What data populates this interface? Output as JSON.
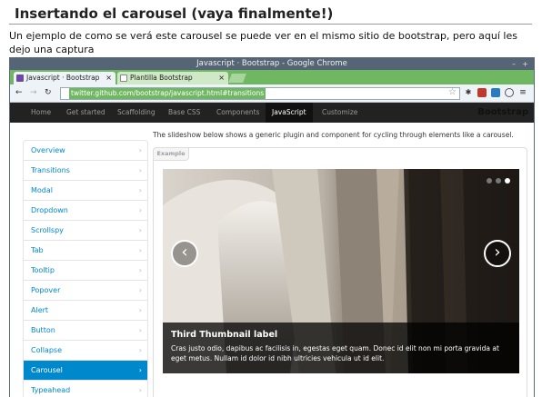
{
  "post": {
    "title": "Insertando el carousel (vaya finalmente!)",
    "intro": "Un ejemplo de como se verá este carousel se puede ver en el mismo sitio de bootstrap, pero aquí les dejo una captura"
  },
  "browser": {
    "window_title": "Javascript · Bootstrap - Google Chrome",
    "win_minimize": "–",
    "win_close": "+",
    "tabs": [
      {
        "label": "Javascript · Bootstrap",
        "close": "×",
        "active": true
      },
      {
        "label": "Plantilla Bootstrap",
        "close": "×",
        "active": false
      }
    ],
    "url": "twitter.github.com/bootstrap/javascript.html#transitions",
    "nav": {
      "back": "←",
      "forward": "→",
      "reload": "↻"
    },
    "star": "☆"
  },
  "bootstrap": {
    "nav_items": [
      "Home",
      "Get started",
      "Scaffolding",
      "Base CSS",
      "Components",
      "JavaScript",
      "Customize"
    ],
    "active_nav": "JavaScript",
    "brand": "Bootstrap",
    "lead": "The slideshow below shows a generic plugin and component for cycling through elements like a carousel.",
    "example_label": "Example",
    "sidenav": [
      {
        "label": "Overview",
        "chev": "›"
      },
      {
        "label": "Transitions",
        "chev": "›"
      },
      {
        "label": "Modal",
        "chev": "›"
      },
      {
        "label": "Dropdown",
        "chev": "›"
      },
      {
        "label": "Scrollspy",
        "chev": "›"
      },
      {
        "label": "Tab",
        "chev": "›"
      },
      {
        "label": "Tooltip",
        "chev": "›"
      },
      {
        "label": "Popover",
        "chev": "›"
      },
      {
        "label": "Alert",
        "chev": "›"
      },
      {
        "label": "Button",
        "chev": "›"
      },
      {
        "label": "Collapse",
        "chev": "›"
      },
      {
        "label": "Carousel",
        "chev": "›"
      },
      {
        "label": "Typeahead",
        "chev": "›"
      }
    ],
    "active_sidenav": "Carousel",
    "carousel": {
      "prev": "‹",
      "next": "›",
      "caption_title": "Third Thumbnail label",
      "caption_text": "Cras justo odio, dapibus ac facilisis in, egestas eget quam. Donec id elit non mi porta gravida at eget metus. Nullam id dolor id nibh ultricies vehicula ut id elit.",
      "indicator_count": 3,
      "active_indicator": 3
    }
  },
  "colors": {
    "link": "#0088cc",
    "tab_green": "#6fb760",
    "navbar": "#222222"
  }
}
